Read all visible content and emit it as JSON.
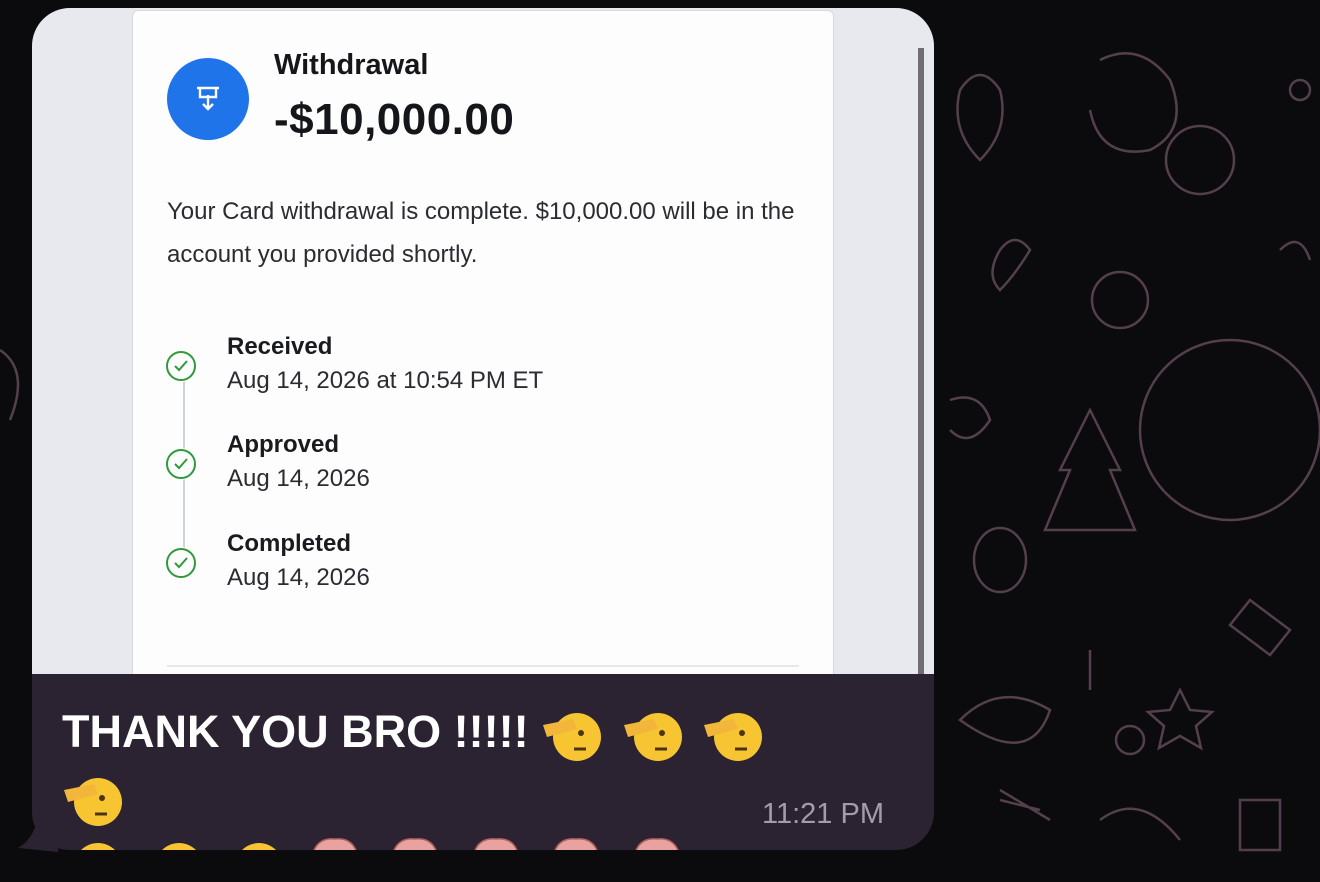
{
  "transaction": {
    "type": "Withdrawal",
    "amount": "-$10,000.00",
    "message": "Your Card withdrawal is complete. $10,000.00 will be in the account you provided shortly.",
    "icon": "bank-withdraw-icon",
    "accent_color": "#1e74e8",
    "status_color": "#2f9a3a",
    "steps": [
      {
        "label": "Received",
        "date": "Aug 14, 2026 at 10:54 PM ET"
      },
      {
        "label": "Approved",
        "date": "Aug 14, 2026"
      },
      {
        "label": "Completed",
        "date": "Aug 14, 2026"
      }
    ]
  },
  "message": {
    "text": "THANK YOU BRO !!!!!",
    "emojis": [
      "saluting-face",
      "saluting-face",
      "saluting-face",
      "saluting-face",
      "saluting-face",
      "saluting-face",
      "saluting-face",
      "exploding-head",
      "exploding-head",
      "exploding-head",
      "exploding-head",
      "exploding-head"
    ],
    "time": "11:21 PM",
    "bubble_color": "#2b2331"
  }
}
